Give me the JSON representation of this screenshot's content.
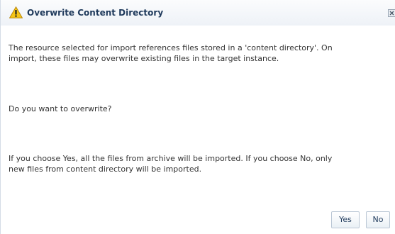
{
  "dialog": {
    "title": "Overwrite Content Directory",
    "title_icon": "warning-icon",
    "close_icon": "close-icon",
    "message_lines_1": [
      "The resource selected for import references files stored in a 'content directory'. On",
      "import, these files may overwrite existing files in the target instance."
    ],
    "question": "Do you want to overwrite?",
    "message_lines_3": [
      "If you choose Yes, all the files from archive will be imported. If you choose No, only",
      "new files from content directory will be imported."
    ],
    "buttons": {
      "yes": "Yes",
      "no": "No"
    }
  },
  "colors": {
    "title_text": "#1f3a5c",
    "warning_fill": "#f5c518",
    "body_text": "#333333"
  }
}
